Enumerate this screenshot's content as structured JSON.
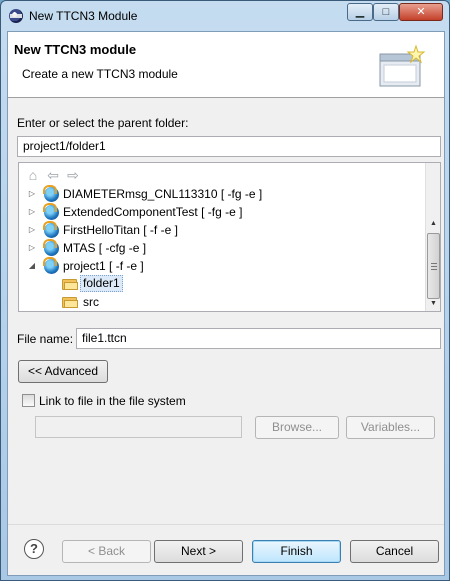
{
  "window": {
    "title": "New TTCN3 Module",
    "controls": {
      "minimize": "▁",
      "maximize": "□",
      "close": "✕"
    }
  },
  "banner": {
    "title": "New TTCN3 module",
    "description": "Create a new TTCN3 module"
  },
  "parent_folder": {
    "label": "Enter or select the parent folder:",
    "value": "project1/folder1"
  },
  "tree": {
    "toolbar": [
      "home-icon",
      "back-arrow-icon",
      "forward-arrow-icon"
    ],
    "items": [
      {
        "label": "DIAMETERmsg_CNL113310 [ -fg -e ]",
        "type": "project",
        "expanded": false
      },
      {
        "label": "ExtendedComponentTest [ -fg -e ]",
        "type": "project",
        "expanded": false
      },
      {
        "label": "FirstHelloTitan [ -f -e ]",
        "type": "project",
        "expanded": false
      },
      {
        "label": "MTAS [ -cfg -e ]",
        "type": "project",
        "expanded": false
      },
      {
        "label": "project1 [ -f -e ]",
        "type": "project",
        "expanded": true
      },
      {
        "label": "folder1",
        "type": "folder",
        "selected": true
      },
      {
        "label": "src",
        "type": "folder"
      }
    ]
  },
  "file_name": {
    "label": "File name:",
    "value": "file1.ttcn"
  },
  "advanced_button": "<< Advanced",
  "link": {
    "checkbox_label": "Link to file in the file system",
    "checked": false,
    "path_value": "",
    "browse_label": "Browse...",
    "variables_label": "Variables..."
  },
  "footer": {
    "help": "?",
    "back_label": "< Back",
    "next_label": "Next >",
    "finish_label": "Finish",
    "cancel_label": "Cancel"
  },
  "colors": {
    "selection_bg": "#dbe9f8",
    "default_button_border": "#3c7fb1"
  }
}
